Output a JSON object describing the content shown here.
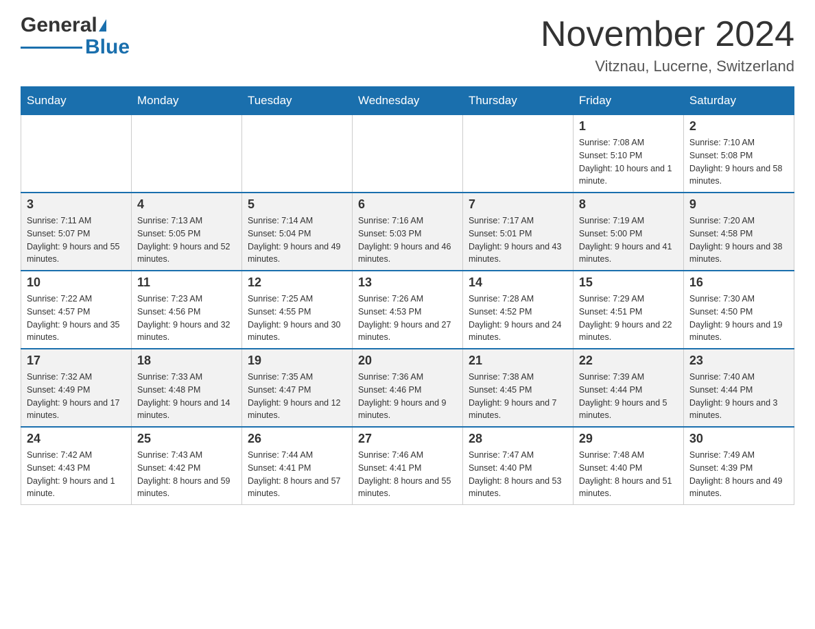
{
  "header": {
    "logo_text1": "General",
    "logo_text2": "Blue",
    "month_title": "November 2024",
    "subtitle": "Vitznau, Lucerne, Switzerland"
  },
  "days_of_week": [
    "Sunday",
    "Monday",
    "Tuesday",
    "Wednesday",
    "Thursday",
    "Friday",
    "Saturday"
  ],
  "weeks": [
    [
      {
        "day": "",
        "info": ""
      },
      {
        "day": "",
        "info": ""
      },
      {
        "day": "",
        "info": ""
      },
      {
        "day": "",
        "info": ""
      },
      {
        "day": "",
        "info": ""
      },
      {
        "day": "1",
        "info": "Sunrise: 7:08 AM\nSunset: 5:10 PM\nDaylight: 10 hours and 1 minute."
      },
      {
        "day": "2",
        "info": "Sunrise: 7:10 AM\nSunset: 5:08 PM\nDaylight: 9 hours and 58 minutes."
      }
    ],
    [
      {
        "day": "3",
        "info": "Sunrise: 7:11 AM\nSunset: 5:07 PM\nDaylight: 9 hours and 55 minutes."
      },
      {
        "day": "4",
        "info": "Sunrise: 7:13 AM\nSunset: 5:05 PM\nDaylight: 9 hours and 52 minutes."
      },
      {
        "day": "5",
        "info": "Sunrise: 7:14 AM\nSunset: 5:04 PM\nDaylight: 9 hours and 49 minutes."
      },
      {
        "day": "6",
        "info": "Sunrise: 7:16 AM\nSunset: 5:03 PM\nDaylight: 9 hours and 46 minutes."
      },
      {
        "day": "7",
        "info": "Sunrise: 7:17 AM\nSunset: 5:01 PM\nDaylight: 9 hours and 43 minutes."
      },
      {
        "day": "8",
        "info": "Sunrise: 7:19 AM\nSunset: 5:00 PM\nDaylight: 9 hours and 41 minutes."
      },
      {
        "day": "9",
        "info": "Sunrise: 7:20 AM\nSunset: 4:58 PM\nDaylight: 9 hours and 38 minutes."
      }
    ],
    [
      {
        "day": "10",
        "info": "Sunrise: 7:22 AM\nSunset: 4:57 PM\nDaylight: 9 hours and 35 minutes."
      },
      {
        "day": "11",
        "info": "Sunrise: 7:23 AM\nSunset: 4:56 PM\nDaylight: 9 hours and 32 minutes."
      },
      {
        "day": "12",
        "info": "Sunrise: 7:25 AM\nSunset: 4:55 PM\nDaylight: 9 hours and 30 minutes."
      },
      {
        "day": "13",
        "info": "Sunrise: 7:26 AM\nSunset: 4:53 PM\nDaylight: 9 hours and 27 minutes."
      },
      {
        "day": "14",
        "info": "Sunrise: 7:28 AM\nSunset: 4:52 PM\nDaylight: 9 hours and 24 minutes."
      },
      {
        "day": "15",
        "info": "Sunrise: 7:29 AM\nSunset: 4:51 PM\nDaylight: 9 hours and 22 minutes."
      },
      {
        "day": "16",
        "info": "Sunrise: 7:30 AM\nSunset: 4:50 PM\nDaylight: 9 hours and 19 minutes."
      }
    ],
    [
      {
        "day": "17",
        "info": "Sunrise: 7:32 AM\nSunset: 4:49 PM\nDaylight: 9 hours and 17 minutes."
      },
      {
        "day": "18",
        "info": "Sunrise: 7:33 AM\nSunset: 4:48 PM\nDaylight: 9 hours and 14 minutes."
      },
      {
        "day": "19",
        "info": "Sunrise: 7:35 AM\nSunset: 4:47 PM\nDaylight: 9 hours and 12 minutes."
      },
      {
        "day": "20",
        "info": "Sunrise: 7:36 AM\nSunset: 4:46 PM\nDaylight: 9 hours and 9 minutes."
      },
      {
        "day": "21",
        "info": "Sunrise: 7:38 AM\nSunset: 4:45 PM\nDaylight: 9 hours and 7 minutes."
      },
      {
        "day": "22",
        "info": "Sunrise: 7:39 AM\nSunset: 4:44 PM\nDaylight: 9 hours and 5 minutes."
      },
      {
        "day": "23",
        "info": "Sunrise: 7:40 AM\nSunset: 4:44 PM\nDaylight: 9 hours and 3 minutes."
      }
    ],
    [
      {
        "day": "24",
        "info": "Sunrise: 7:42 AM\nSunset: 4:43 PM\nDaylight: 9 hours and 1 minute."
      },
      {
        "day": "25",
        "info": "Sunrise: 7:43 AM\nSunset: 4:42 PM\nDaylight: 8 hours and 59 minutes."
      },
      {
        "day": "26",
        "info": "Sunrise: 7:44 AM\nSunset: 4:41 PM\nDaylight: 8 hours and 57 minutes."
      },
      {
        "day": "27",
        "info": "Sunrise: 7:46 AM\nSunset: 4:41 PM\nDaylight: 8 hours and 55 minutes."
      },
      {
        "day": "28",
        "info": "Sunrise: 7:47 AM\nSunset: 4:40 PM\nDaylight: 8 hours and 53 minutes."
      },
      {
        "day": "29",
        "info": "Sunrise: 7:48 AM\nSunset: 4:40 PM\nDaylight: 8 hours and 51 minutes."
      },
      {
        "day": "30",
        "info": "Sunrise: 7:49 AM\nSunset: 4:39 PM\nDaylight: 8 hours and 49 minutes."
      }
    ]
  ]
}
